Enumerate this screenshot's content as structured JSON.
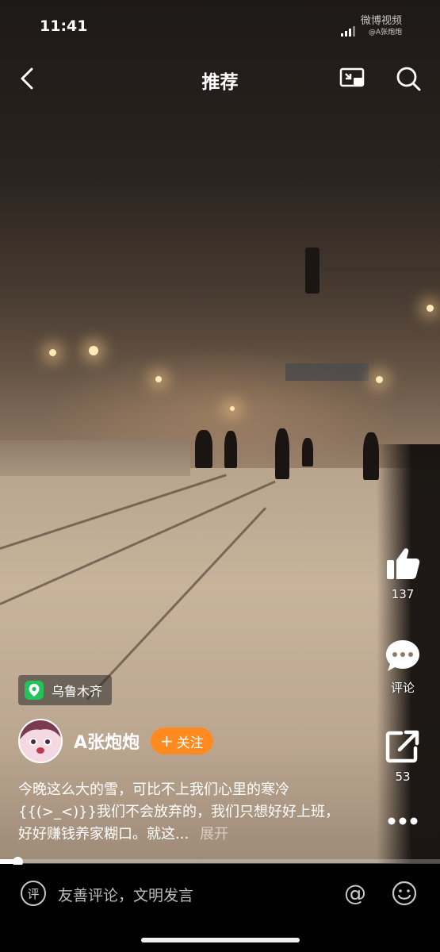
{
  "status_bar": {
    "time": "11:41",
    "watermark_top": "微博视频",
    "watermark_bottom": "@A张炮炮"
  },
  "nav": {
    "title": "推荐"
  },
  "actions": {
    "like_count": "137",
    "comment_label": "评论",
    "share_count": "53"
  },
  "location": {
    "name": "乌鲁木齐"
  },
  "author": {
    "name": "A张炮炮",
    "follow_label": "关注"
  },
  "caption": {
    "text": "今晚这么大的雪，可比不上我们心里的寒冷{{(>_<)}}我们不会放弃的，我们只想好好上班，好好赚钱养家糊口。就这...",
    "more_label": "展开"
  },
  "video": {
    "progress_fraction": 0.04
  },
  "comment_bar": {
    "placeholder": "友善评论，文明发言",
    "icon_char": "评"
  },
  "colors": {
    "follow": "#ff8a1f",
    "location_pin": "#23c25a"
  }
}
